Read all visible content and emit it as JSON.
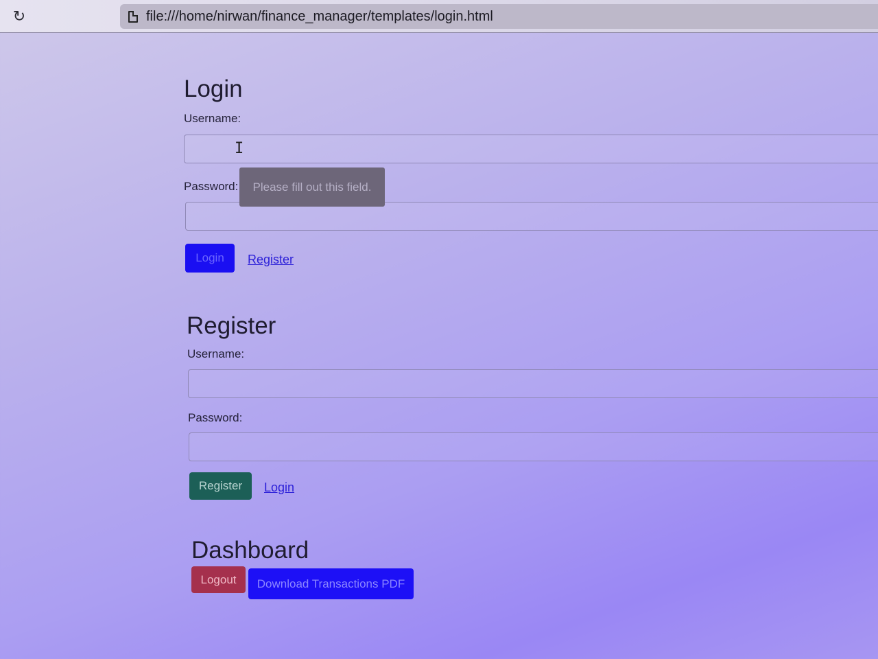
{
  "browser": {
    "url": "file:///home/nirwan/finance_manager/templates/login.html",
    "reload_icon": "reload-icon",
    "page_icon": "page-icon"
  },
  "login": {
    "title": "Login",
    "username_label": "Username:",
    "password_label": "Password:",
    "submit_label": "Login",
    "register_link": "Register",
    "validation_tooltip": "Please fill out this field."
  },
  "register": {
    "title": "Register",
    "username_label": "Username:",
    "password_label": "Password:",
    "submit_label": "Register",
    "login_link": "Login"
  },
  "dashboard": {
    "title": "Dashboard",
    "logout_label": "Logout",
    "download_label": "Download Transactions PDF"
  },
  "colors": {
    "primary": "#1a0ff2",
    "success": "#1c5f57",
    "danger": "#a5304d"
  }
}
